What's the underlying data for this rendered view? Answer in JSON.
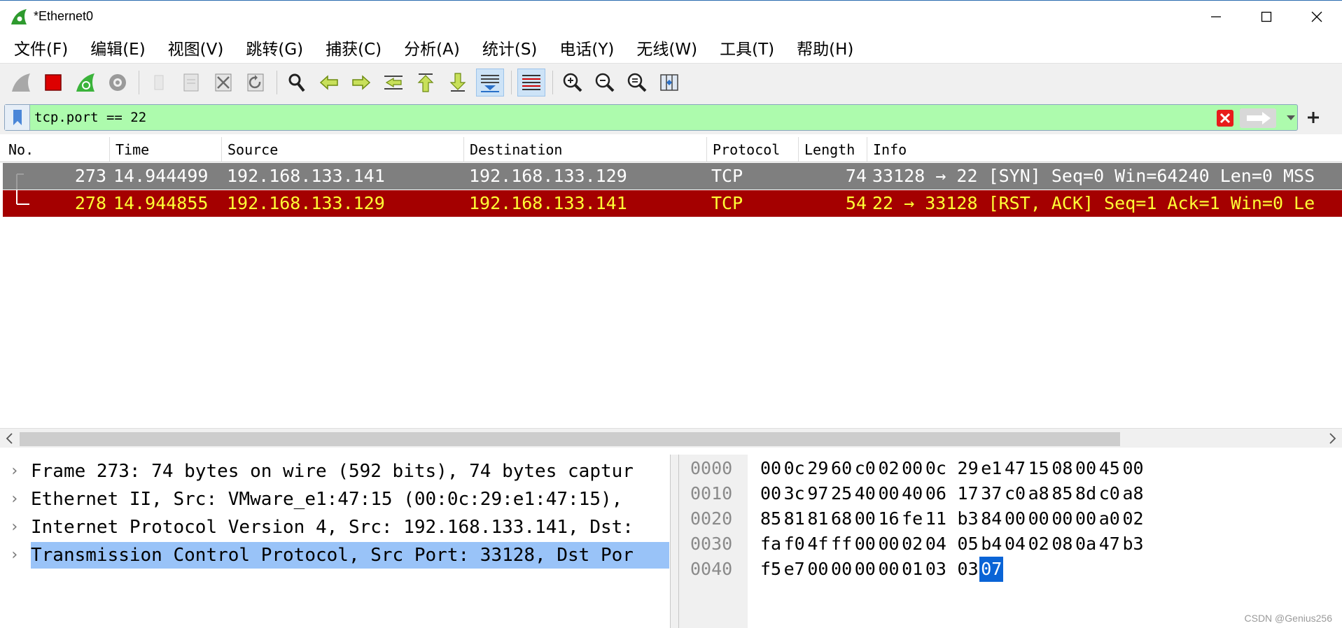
{
  "window": {
    "title": "*Ethernet0"
  },
  "menu": [
    "文件(F)",
    "编辑(E)",
    "视图(V)",
    "跳转(G)",
    "捕获(C)",
    "分析(A)",
    "统计(S)",
    "电话(Y)",
    "无线(W)",
    "工具(T)",
    "帮助(H)"
  ],
  "toolbar": {
    "icons": [
      "shark-fin-start-icon",
      "stop-capture-icon",
      "restart-capture-icon",
      "capture-options-icon",
      "open-file-icon",
      "save-file-icon",
      "close-file-icon",
      "reload-file-icon",
      "find-packet-icon",
      "go-back-icon",
      "go-forward-icon",
      "go-to-packet-icon",
      "first-packet-icon",
      "last-packet-icon",
      "auto-scroll-icon",
      "colorize-icon",
      "zoom-in-icon",
      "zoom-out-icon",
      "zoom-normal-icon",
      "resize-columns-icon"
    ]
  },
  "filter": {
    "value": "tcp.port == 22",
    "background": "#adfbad"
  },
  "packet_list": {
    "columns": [
      "No.",
      "Time",
      "Source",
      "Destination",
      "Protocol",
      "Length",
      "Info"
    ],
    "rows": [
      {
        "no": "273",
        "time": "14.944499",
        "source": "192.168.133.141",
        "destination": "192.168.133.129",
        "protocol": "TCP",
        "length": "74",
        "info": "33128 → 22 [SYN] Seq=0 Win=64240 Len=0 MSS"
      },
      {
        "no": "278",
        "time": "14.944855",
        "source": "192.168.133.129",
        "destination": "192.168.133.141",
        "protocol": "TCP",
        "length": "54",
        "info": "22 → 33128 [RST, ACK] Seq=1 Ack=1 Win=0 Le"
      }
    ]
  },
  "details": [
    "Frame 273: 74 bytes on wire (592 bits), 74 bytes captur",
    "Ethernet II, Src: VMware_e1:47:15 (00:0c:29:e1:47:15),",
    "Internet Protocol Version 4, Src: 192.168.133.141, Dst:",
    "Transmission Control Protocol, Src Port: 33128, Dst Por"
  ],
  "bytes": {
    "rows": [
      {
        "offset": "0000",
        "hex": [
          "00",
          "0c",
          "29",
          "60",
          "c0",
          "02",
          "00",
          "0c",
          "29",
          "e1",
          "47",
          "15",
          "08",
          "00",
          "45",
          "00"
        ]
      },
      {
        "offset": "0010",
        "hex": [
          "00",
          "3c",
          "97",
          "25",
          "40",
          "00",
          "40",
          "06",
          "17",
          "37",
          "c0",
          "a8",
          "85",
          "8d",
          "c0",
          "a8"
        ]
      },
      {
        "offset": "0020",
        "hex": [
          "85",
          "81",
          "81",
          "68",
          "00",
          "16",
          "fe",
          "11",
          "b3",
          "84",
          "00",
          "00",
          "00",
          "00",
          "a0",
          "02"
        ]
      },
      {
        "offset": "0030",
        "hex": [
          "fa",
          "f0",
          "4f",
          "ff",
          "00",
          "00",
          "02",
          "04",
          "05",
          "b4",
          "04",
          "02",
          "08",
          "0a",
          "47",
          "b3"
        ]
      },
      {
        "offset": "0040",
        "hex": [
          "f5",
          "e7",
          "00",
          "00",
          "00",
          "00",
          "01",
          "03",
          "03",
          "07"
        ]
      }
    ]
  },
  "watermark": "CSDN @Genius256"
}
